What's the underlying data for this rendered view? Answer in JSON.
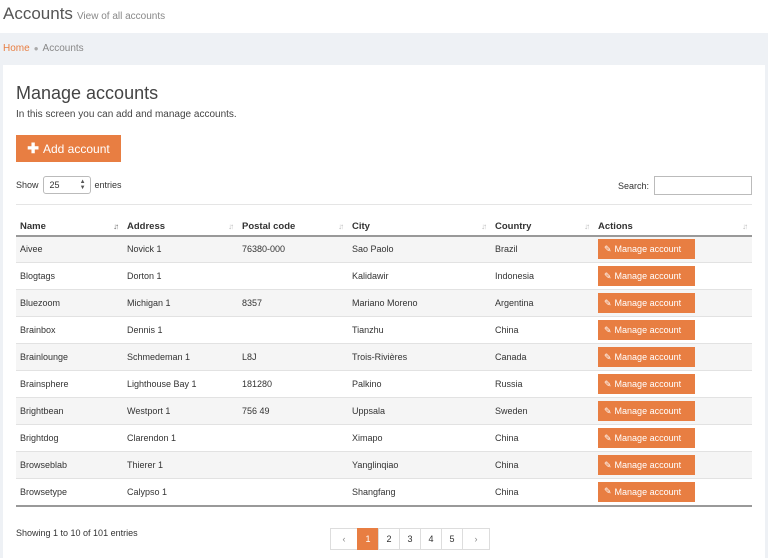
{
  "header": {
    "title": "Accounts",
    "subtitle": "View of all accounts"
  },
  "breadcrumb": {
    "home": "Home",
    "separator": "●",
    "current": "Accounts"
  },
  "main": {
    "title": "Manage accounts",
    "description": "In this screen you can add and manage accounts.",
    "add_button": "Add account"
  },
  "controls": {
    "show_label": "Show",
    "entries_value": "25",
    "entries_label": "entries",
    "search_label": "Search:"
  },
  "table": {
    "columns": [
      "Name",
      "Address",
      "Postal code",
      "City",
      "Country",
      "Actions"
    ],
    "action_label": "Manage account",
    "rows": [
      {
        "name": "Aivee",
        "address": "Novick 1",
        "postal": "76380-000",
        "city": "Sao Paolo",
        "country": "Brazil"
      },
      {
        "name": "Blogtags",
        "address": "Dorton 1",
        "postal": "",
        "city": "Kalidawir",
        "country": "Indonesia"
      },
      {
        "name": "Bluezoom",
        "address": "Michigan 1",
        "postal": "8357",
        "city": "Mariano Moreno",
        "country": "Argentina"
      },
      {
        "name": "Brainbox",
        "address": "Dennis 1",
        "postal": "",
        "city": "Tianzhu",
        "country": "China"
      },
      {
        "name": "Brainlounge",
        "address": "Schmedeman 1",
        "postal": "L8J",
        "city": "Trois-Rivières",
        "country": "Canada"
      },
      {
        "name": "Brainsphere",
        "address": "Lighthouse Bay 1",
        "postal": "181280",
        "city": "Palkino",
        "country": "Russia"
      },
      {
        "name": "Brightbean",
        "address": "Westport 1",
        "postal": "756 49",
        "city": "Uppsala",
        "country": "Sweden"
      },
      {
        "name": "Brightdog",
        "address": "Clarendon 1",
        "postal": "",
        "city": "Ximapo",
        "country": "China"
      },
      {
        "name": "Browseblab",
        "address": "Thierer 1",
        "postal": "",
        "city": "Yanglinqiao",
        "country": "China"
      },
      {
        "name": "Browsetype",
        "address": "Calypso 1",
        "postal": "",
        "city": "Shangfang",
        "country": "China"
      }
    ]
  },
  "footer": {
    "info": "Showing 1 to 10 of 101 entries",
    "pages": [
      "1",
      "2",
      "3",
      "4",
      "5"
    ],
    "prev": "‹",
    "next": "›",
    "active_page": "1"
  },
  "icons": {
    "plus": "plus-icon",
    "edit": "edit-icon",
    "sort": "sort-icon"
  },
  "colors": {
    "accent": "#e87e42"
  }
}
